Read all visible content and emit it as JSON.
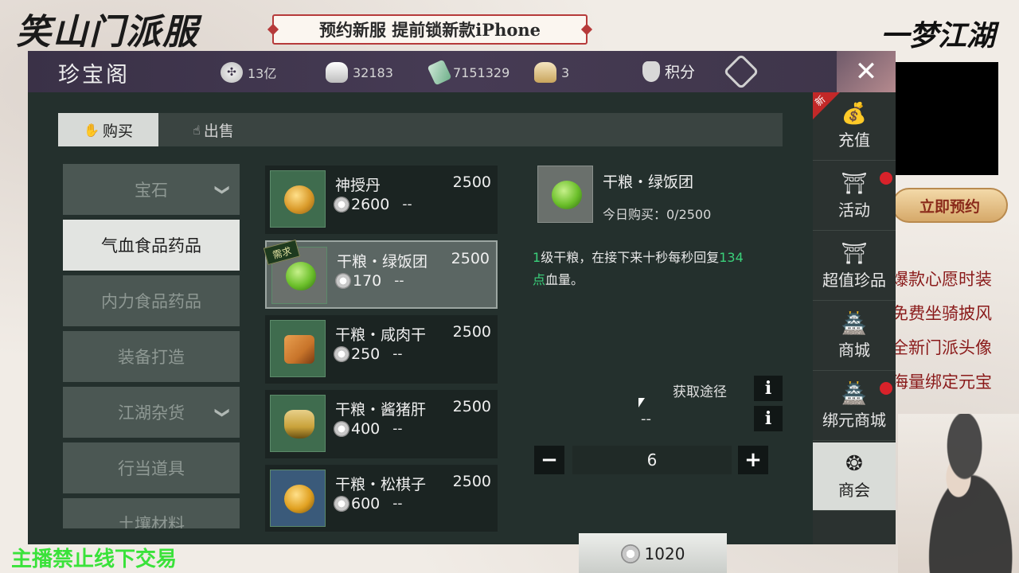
{
  "stream": {
    "logo_left": "笑山门派服",
    "banner": "预约新服 提前锁新款iPhone",
    "logo_right": "一梦江湖",
    "cta": "立即预约",
    "promo_lines": [
      "爆款心愿时装",
      "免费坐骑披风",
      "全新门派头像",
      "海量绑定元宝"
    ],
    "streamer_note": "主播禁止线下交易"
  },
  "header": {
    "title": "珍宝阁",
    "currencies": [
      {
        "icon": "coin-icon",
        "value": "13亿"
      },
      {
        "icon": "silver-icon",
        "value": "32183"
      },
      {
        "icon": "jade-icon",
        "value": "7151329"
      },
      {
        "icon": "ingot-icon",
        "value": "3"
      }
    ],
    "score_label": "积分",
    "close_symbol": "✕"
  },
  "tabs": {
    "buy": "购买",
    "sell": "出售"
  },
  "categories": [
    {
      "label": "宝石",
      "chevron": "❯"
    },
    {
      "label": "气血食品药品"
    },
    {
      "label": "内力食品药品"
    },
    {
      "label": "装备打造"
    },
    {
      "label": "江湖杂货",
      "chevron": "❯"
    },
    {
      "label": "行当道具"
    },
    {
      "label": "土壤材料"
    }
  ],
  "items": [
    {
      "name": "神授丹",
      "qty": "2500",
      "price": "2600",
      "dash": "--",
      "color": "#d99a2a"
    },
    {
      "name": "干粮・绿饭团",
      "qty": "2500",
      "price": "170",
      "dash": "--",
      "tag": "需求",
      "color": "#6bbf2a"
    },
    {
      "name": "干粮・咸肉干",
      "qty": "2500",
      "price": "250",
      "dash": "--",
      "color": "#c8742a"
    },
    {
      "name": "干粮・酱猪肝",
      "qty": "2500",
      "price": "400",
      "dash": "--",
      "color": "#c9a23a"
    },
    {
      "name": "干粮・松棋子",
      "qty": "2500",
      "price": "600",
      "dash": "--",
      "color": "#e0a020"
    }
  ],
  "detail": {
    "name": "干粮・绿饭团",
    "daily": "今日购买：0/2500",
    "desc_a": "1",
    "desc_b": "级干粮，在接下来十秒每秒回复",
    "desc_c": "134",
    "desc_d": "点",
    "desc_e": "血量。",
    "source_label": "获取途径",
    "info": "i",
    "dash": "--",
    "minus": "−",
    "plus": "+",
    "quantity": "6",
    "total_price": "1020"
  },
  "right_nav": [
    {
      "label": "充值",
      "badge": "新"
    },
    {
      "label": "活动",
      "dot": true
    },
    {
      "label": "超值珍品"
    },
    {
      "label": "商城"
    },
    {
      "label": "绑元商城",
      "dot": true
    },
    {
      "label": "商会"
    }
  ]
}
